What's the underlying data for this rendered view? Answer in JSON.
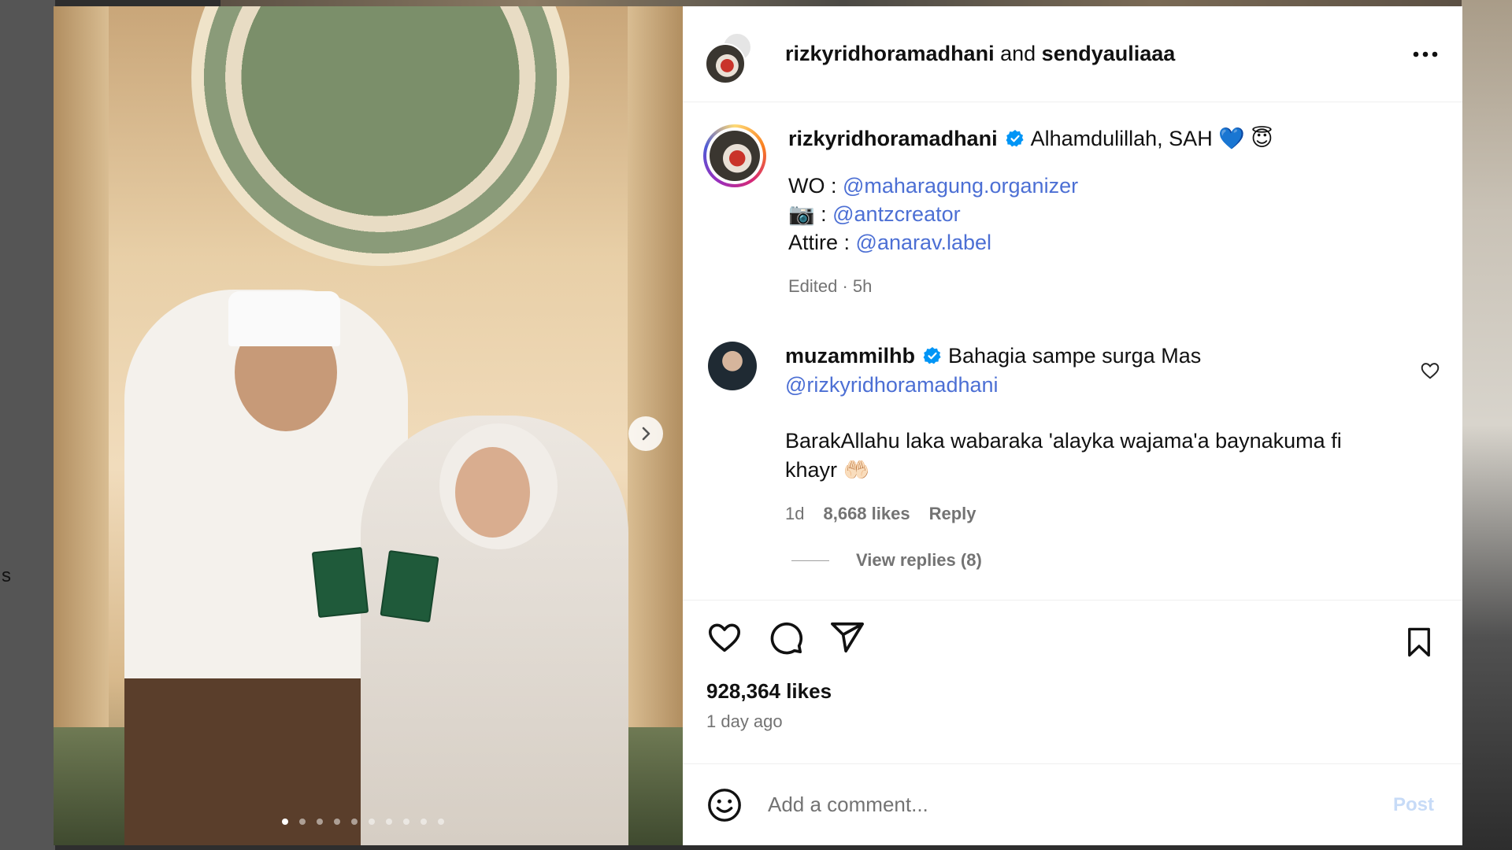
{
  "header": {
    "user1": "rizkyridhoramadhani",
    "joiner": "and",
    "user2": "sendyauliaaa",
    "more_icon": "more-horizontal-icon"
  },
  "carousel": {
    "next_icon": "chevron-right-icon",
    "slide_count": 10,
    "active_slide": 1
  },
  "caption": {
    "username": "rizkyridhoramadhani",
    "text": "Alhamdulillah, SAH",
    "emoji": "💙 😇",
    "lines": [
      {
        "prefix": "WO : ",
        "mention": "@maharagung.organizer"
      },
      {
        "prefix": "📷 : ",
        "mention": "@antzcreator"
      },
      {
        "prefix": "Attire : ",
        "mention": "@anarav.label"
      }
    ],
    "meta": "Edited · 5h"
  },
  "comment": {
    "username": "muzammilhb",
    "text": "Bahagia sampe surga Mas",
    "mention": "@rizkyridhoramadhani",
    "text2": "BarakAllahu laka wabaraka 'alayka wajama'a baynakuma fi khayr",
    "emoji": "🤲🏻",
    "age": "1d",
    "likes": "8,668 likes",
    "reply": "Reply",
    "view_replies": "View replies (8)"
  },
  "actions": {
    "likes": "928,364 likes",
    "time_ago": "1 day ago"
  },
  "add_comment": {
    "placeholder": "Add a comment...",
    "post_label": "Post"
  },
  "background": {
    "edge_text": "s"
  },
  "colors": {
    "mention": "#4c6fd4",
    "verified": "#0095f6",
    "post_disabled": "#c7dbf7"
  }
}
